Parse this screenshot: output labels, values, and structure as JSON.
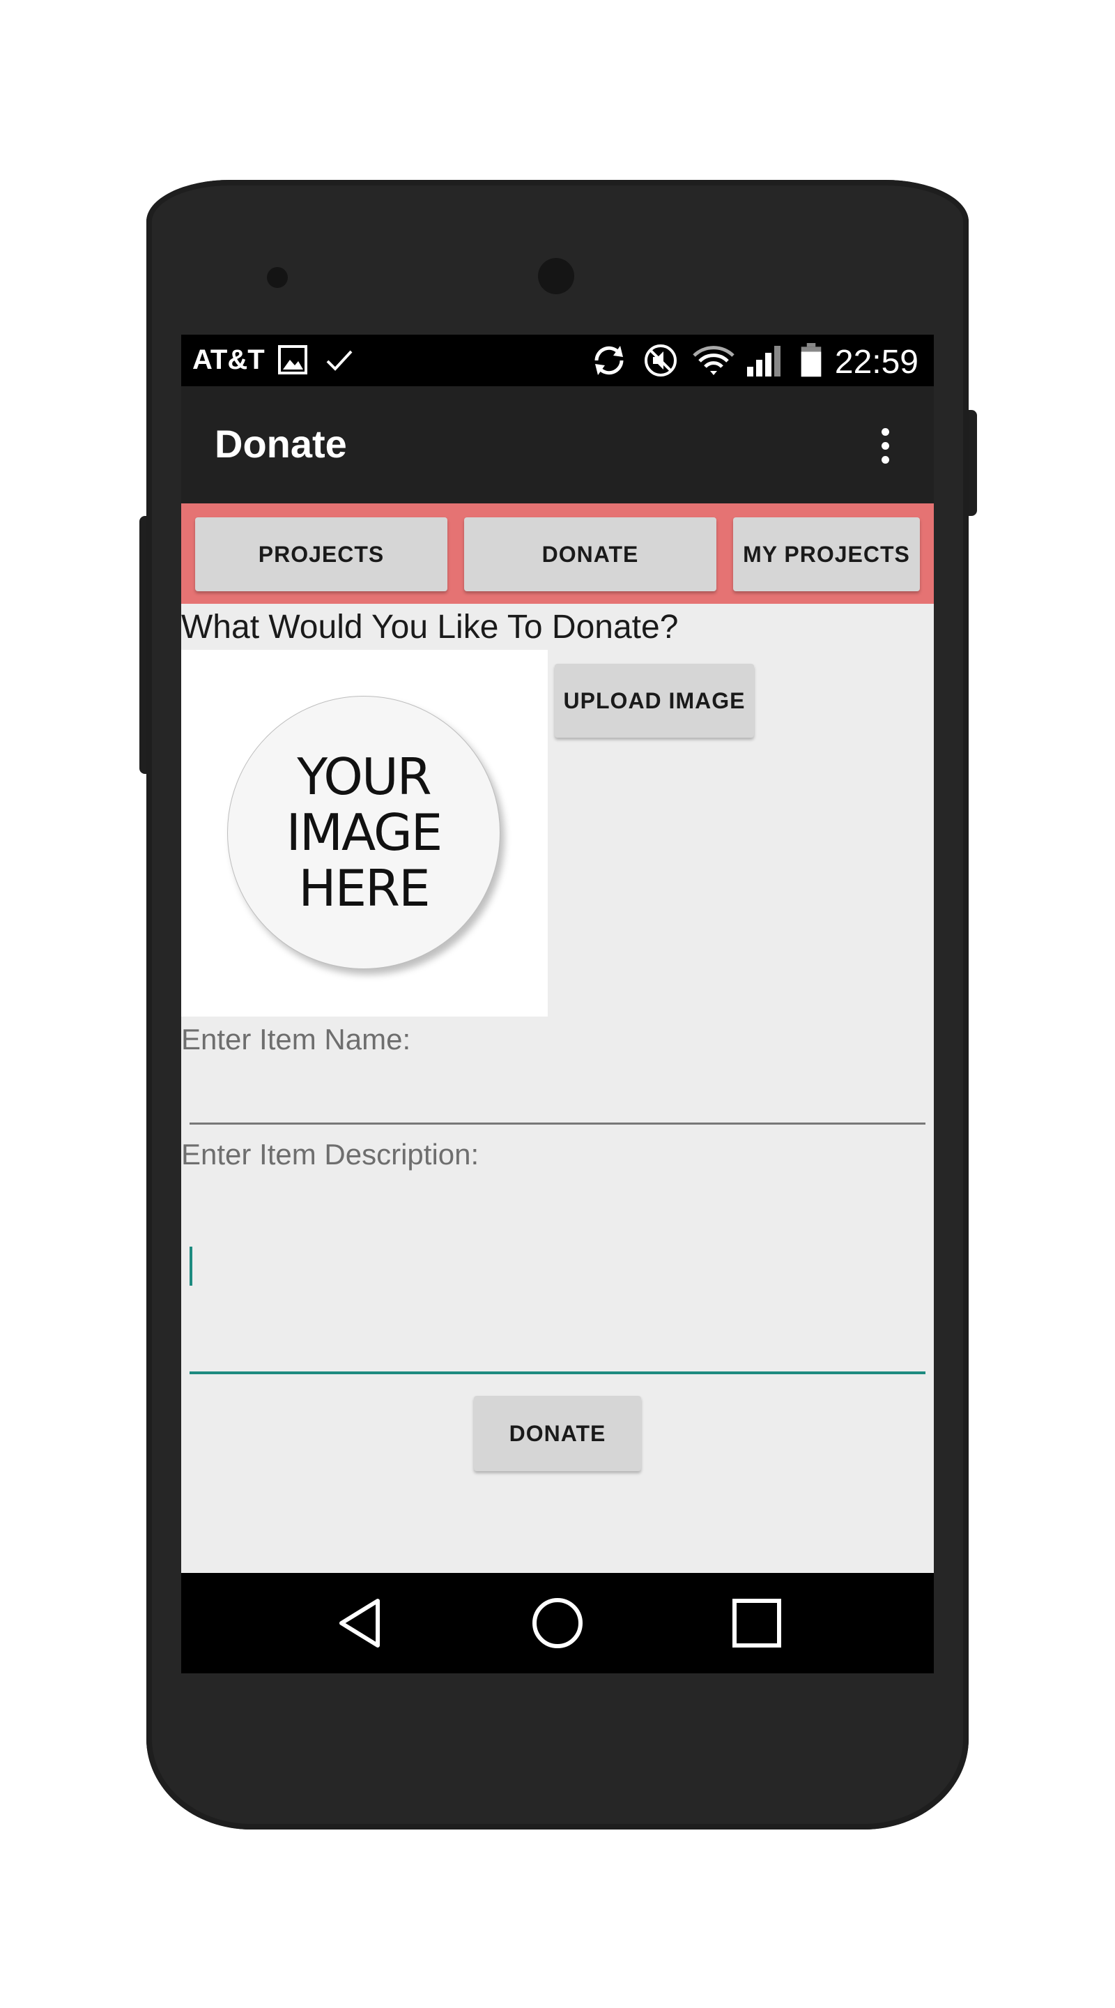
{
  "status_bar": {
    "carrier": "AT&T",
    "time": "22:59",
    "icons": [
      "image-notification-icon",
      "check-icon",
      "sync-icon",
      "mute-icon",
      "wifi-icon",
      "signal-icon",
      "battery-icon"
    ]
  },
  "app_bar": {
    "title": "Donate",
    "menu_icon": "overflow-menu-icon"
  },
  "tabs": [
    {
      "label": "PROJECTS"
    },
    {
      "label": "DONATE"
    },
    {
      "label": "MY PROJECTS"
    }
  ],
  "form": {
    "question": "What Would You Like To Donate?",
    "placeholder_image_text": [
      "YOUR",
      "IMAGE",
      "HERE"
    ],
    "upload_label": "UPLOAD IMAGE",
    "item_name_label": "Enter Item Name:",
    "item_name_value": "",
    "item_description_label": "Enter Item Description:",
    "item_description_value": "",
    "submit_label": "DONATE"
  },
  "nav_bar": {
    "icons": [
      "back-icon",
      "home-icon",
      "recents-icon"
    ]
  },
  "colors": {
    "tab_strip": "#e57373",
    "app_bar": "#212121",
    "accent": "#1e8b80",
    "background": "#ededed"
  }
}
